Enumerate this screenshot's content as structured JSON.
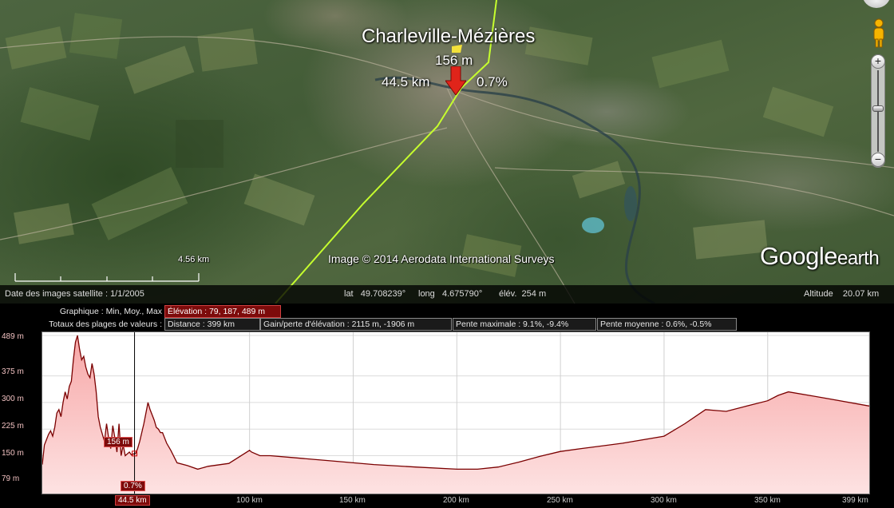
{
  "map": {
    "city_label": "Charleville-Mézières",
    "probe": {
      "elevation": "156 m",
      "distance": "44.5 km",
      "slope": "0.7%"
    },
    "attribution": "Image © 2014 Aerodata International Surveys",
    "logo": {
      "brand": "Google",
      "product": "earth"
    },
    "scale_label": "4.56  km",
    "icons": [
      "north-arrow-icon",
      "street-view-pegman-icon",
      "zoom-in-icon",
      "zoom-out-icon"
    ],
    "zoom_controls": {
      "zoom_in": "+",
      "zoom_out": "−"
    }
  },
  "status_bar": {
    "imagery_date": "Date des images satellite : 1/1/2005",
    "lat": "lat   49.708239°",
    "long": "long   4.675790°",
    "elev": "élév.  254 m",
    "altitude": "Altitude    20.07 km"
  },
  "profile": {
    "graph_label": "Graphique : Min, Moy., Max",
    "graph_value": "Élévation : 79, 187, 489 m",
    "totals_label": "Totaux des plages de valeurs :",
    "totals": {
      "distance": "Distance : 399 km",
      "gain_loss": "Gain/perte d'élévation : 2115 m, -1906 m",
      "max_slope": "Pente maximale : 9.1%, -9.4%",
      "avg_slope": "Pente moyenne : 0.6%, -0.5%"
    },
    "y_ticks": [
      "489 m",
      "375 m",
      "300 m",
      "225 m",
      "150 m",
      "79 m"
    ],
    "x_ticks": [
      "100 km",
      "150 km",
      "200 km",
      "250 km",
      "300 km",
      "350 km",
      "399 km"
    ],
    "cursor": {
      "distance": "44.5 km",
      "elevation": "156 m",
      "slope": "0.7%"
    },
    "colors": {
      "fill": "#f7b8b8",
      "line": "#7a0000",
      "highlight": "#7d0b0b"
    }
  },
  "chart_data": {
    "type": "area",
    "xlabel": "",
    "ylabel": "",
    "xlim": [
      0,
      399
    ],
    "ylim": [
      79,
      489
    ],
    "x_ticks": [
      100,
      150,
      200,
      250,
      300,
      350,
      399
    ],
    "y_ticks": [
      79,
      150,
      225,
      300,
      375,
      489
    ],
    "cursor_x": 44.5,
    "series": [
      {
        "x": [
          0,
          1,
          2,
          3,
          4,
          5,
          6,
          7,
          8,
          9,
          10,
          11,
          12,
          13,
          14,
          15,
          16,
          17,
          18,
          19,
          20,
          21,
          22,
          23,
          24,
          25,
          26,
          27,
          28,
          29,
          30,
          31,
          32,
          33,
          34,
          35,
          36,
          37,
          38,
          39,
          40,
          41,
          42,
          43,
          44,
          45,
          46,
          47,
          48,
          49,
          50,
          51,
          52,
          53,
          54,
          55,
          56,
          57,
          58,
          60,
          62,
          65,
          70,
          75,
          80,
          90,
          100,
          101,
          105,
          110,
          120,
          140,
          160,
          180,
          200,
          210,
          220,
          230,
          240,
          250,
          260,
          280,
          300,
          310,
          320,
          330,
          340,
          350,
          355,
          360,
          370,
          380,
          399
        ],
        "values": [
          125,
          180,
          195,
          210,
          220,
          205,
          230,
          270,
          280,
          260,
          300,
          330,
          310,
          345,
          360,
          420,
          470,
          489,
          450,
          420,
          430,
          400,
          380,
          370,
          410,
          380,
          330,
          260,
          230,
          210,
          190,
          240,
          200,
          170,
          235,
          200,
          160,
          240,
          150,
          180,
          150,
          155,
          160,
          152,
          155,
          156,
          170,
          190,
          215,
          240,
          270,
          300,
          280,
          265,
          250,
          230,
          225,
          215,
          215,
          185,
          165,
          130,
          122,
          112,
          120,
          128,
          165,
          160,
          150,
          150,
          145,
          135,
          125,
          118,
          112,
          112,
          118,
          132,
          148,
          162,
          170,
          185,
          205,
          240,
          280,
          275,
          290,
          305,
          320,
          330,
          320,
          310,
          290
        ]
      }
    ]
  }
}
